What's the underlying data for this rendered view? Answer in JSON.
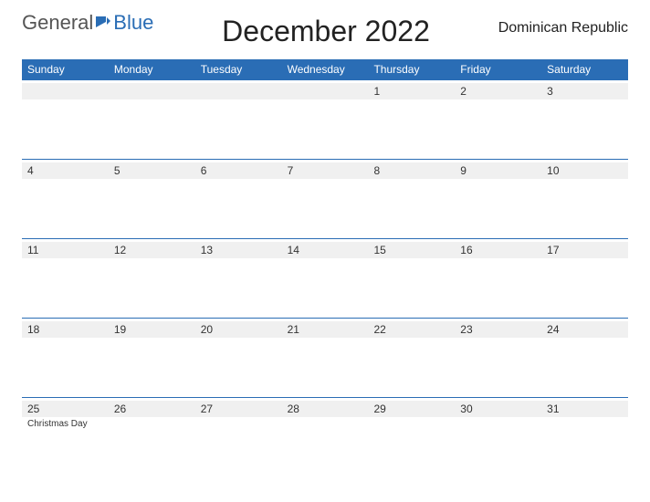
{
  "logo": {
    "general": "General",
    "blue": "Blue"
  },
  "title": "December 2022",
  "country": "Dominican Republic",
  "weekdays": [
    "Sunday",
    "Monday",
    "Tuesday",
    "Wednesday",
    "Thursday",
    "Friday",
    "Saturday"
  ],
  "weeks": [
    {
      "days": [
        {
          "date": ""
        },
        {
          "date": ""
        },
        {
          "date": ""
        },
        {
          "date": ""
        },
        {
          "date": "1"
        },
        {
          "date": "2"
        },
        {
          "date": "3"
        }
      ]
    },
    {
      "days": [
        {
          "date": "4"
        },
        {
          "date": "5"
        },
        {
          "date": "6"
        },
        {
          "date": "7"
        },
        {
          "date": "8"
        },
        {
          "date": "9"
        },
        {
          "date": "10"
        }
      ]
    },
    {
      "days": [
        {
          "date": "11"
        },
        {
          "date": "12"
        },
        {
          "date": "13"
        },
        {
          "date": "14"
        },
        {
          "date": "15"
        },
        {
          "date": "16"
        },
        {
          "date": "17"
        }
      ]
    },
    {
      "days": [
        {
          "date": "18"
        },
        {
          "date": "19"
        },
        {
          "date": "20"
        },
        {
          "date": "21"
        },
        {
          "date": "22"
        },
        {
          "date": "23"
        },
        {
          "date": "24"
        }
      ]
    },
    {
      "days": [
        {
          "date": "25",
          "event": "Christmas Day"
        },
        {
          "date": "26"
        },
        {
          "date": "27"
        },
        {
          "date": "28"
        },
        {
          "date": "29"
        },
        {
          "date": "30"
        },
        {
          "date": "31"
        }
      ]
    }
  ]
}
